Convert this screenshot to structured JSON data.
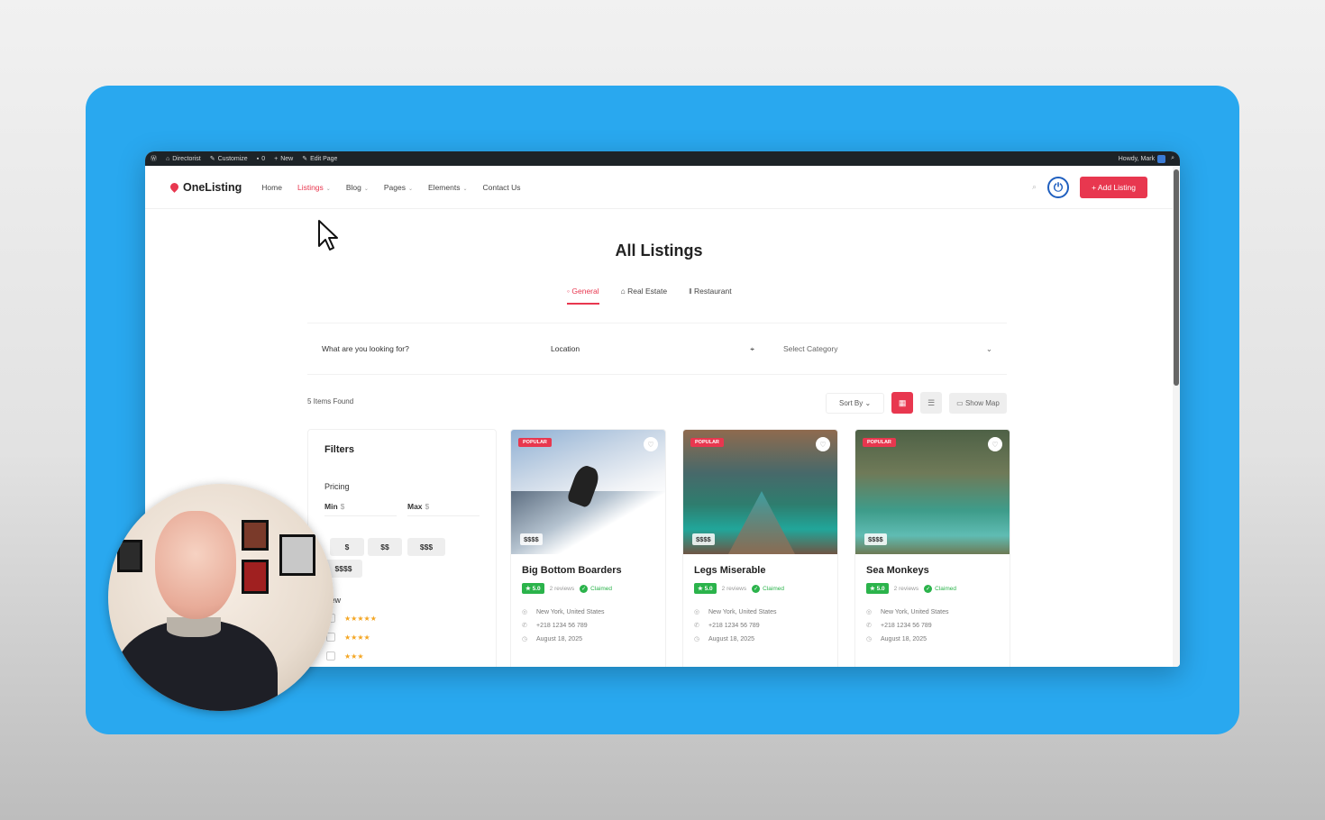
{
  "wp_bar": {
    "site": "Directorist",
    "customize": "Customize",
    "comments": "0",
    "new": "New",
    "edit": "Edit Page",
    "howdy": "Howdy, Mark"
  },
  "nav": {
    "logo": "OneListing",
    "menu": [
      "Home",
      "Listings",
      "Blog",
      "Pages",
      "Elements",
      "Contact Us"
    ],
    "add_listing": "+ Add Listing"
  },
  "page": {
    "title": "All Listings",
    "tabs": [
      "General",
      "Real Estate",
      "Restaurant"
    ]
  },
  "search": {
    "keyword": "What are you looking for?",
    "location": "Location",
    "category": "Select Category"
  },
  "results": {
    "found": "5 Items Found",
    "sort_by": "Sort By",
    "show_map": "Show Map"
  },
  "filters": {
    "title": "Filters",
    "pricing": "Pricing",
    "min": "Min",
    "max": "Max",
    "currency": "$",
    "price_levels": [
      "$",
      "$$",
      "$$$",
      "$$$$"
    ],
    "review": "view"
  },
  "listings": [
    {
      "badge": "POPULAR",
      "price": "$$$$",
      "name": "Big Bottom Boarders",
      "rating": "★ 5.0",
      "reviews": "2 reviews",
      "claimed": "Claimed",
      "location": "New York, United States",
      "phone": "+218 1234 56 789",
      "date": "August 18, 2025"
    },
    {
      "badge": "POPULAR",
      "price": "$$$$",
      "name": "Legs Miserable",
      "rating": "★ 5.0",
      "reviews": "2 reviews",
      "claimed": "Claimed",
      "location": "New York, United States",
      "phone": "+218 1234 56 789",
      "date": "August 18, 2025"
    },
    {
      "badge": "POPULAR",
      "price": "$$$$",
      "name": "Sea Monkeys",
      "rating": "★ 5.0",
      "reviews": "2 reviews",
      "claimed": "Claimed",
      "location": "New York, United States",
      "phone": "+218 1234 56 789",
      "date": "August 18, 2025"
    }
  ],
  "colors": {
    "accent": "#e8374f",
    "stage": "#29a8ef",
    "success": "#2bb34b"
  }
}
